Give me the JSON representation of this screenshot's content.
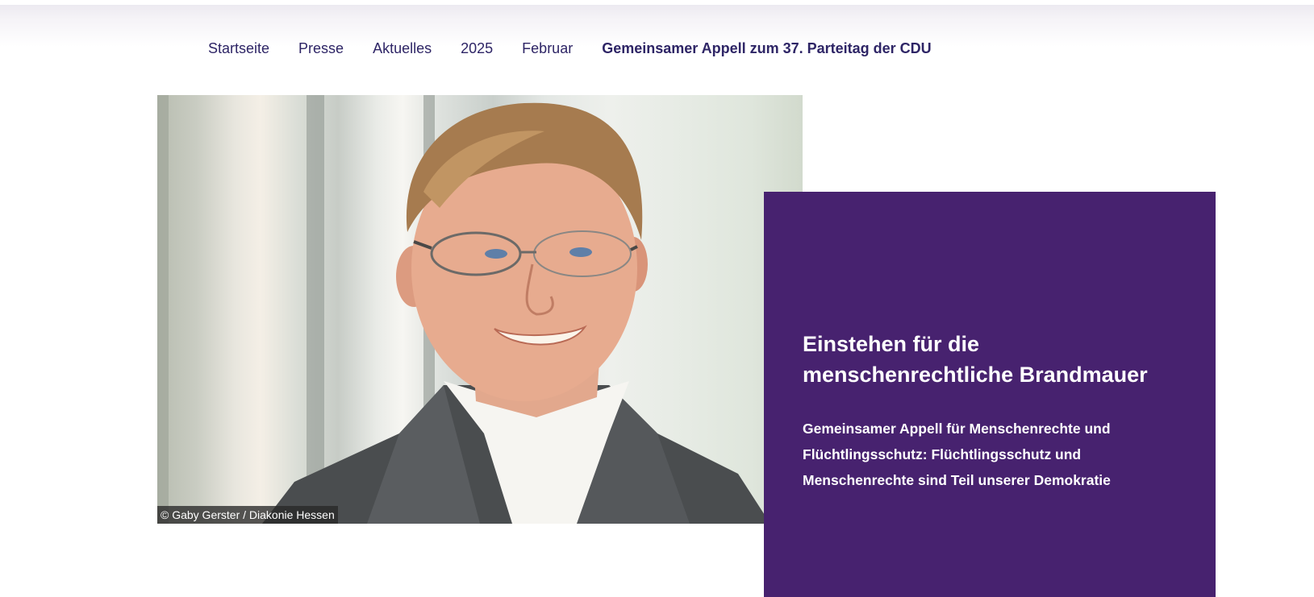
{
  "breadcrumb": {
    "items": [
      {
        "label": "Startseite"
      },
      {
        "label": "Presse"
      },
      {
        "label": "Aktuelles"
      },
      {
        "label": "2025"
      },
      {
        "label": "Februar"
      }
    ],
    "current": "Gemeinsamer Appell zum 37. Parteitag der CDU"
  },
  "hero": {
    "photo_credit": "© Gaby Gerster / Diakonie Hessen",
    "title": "Einstehen für die menschenrechtliche Brandmauer",
    "subtitle": "Gemeinsamer Appell für Menschenrechte und Flüchtlingsschutz: Flüchtlingsschutz und Menschenrechte sind Teil unserer Demokratie"
  },
  "colors": {
    "brand_purple": "#47226f",
    "link_color": "#2e2566"
  }
}
